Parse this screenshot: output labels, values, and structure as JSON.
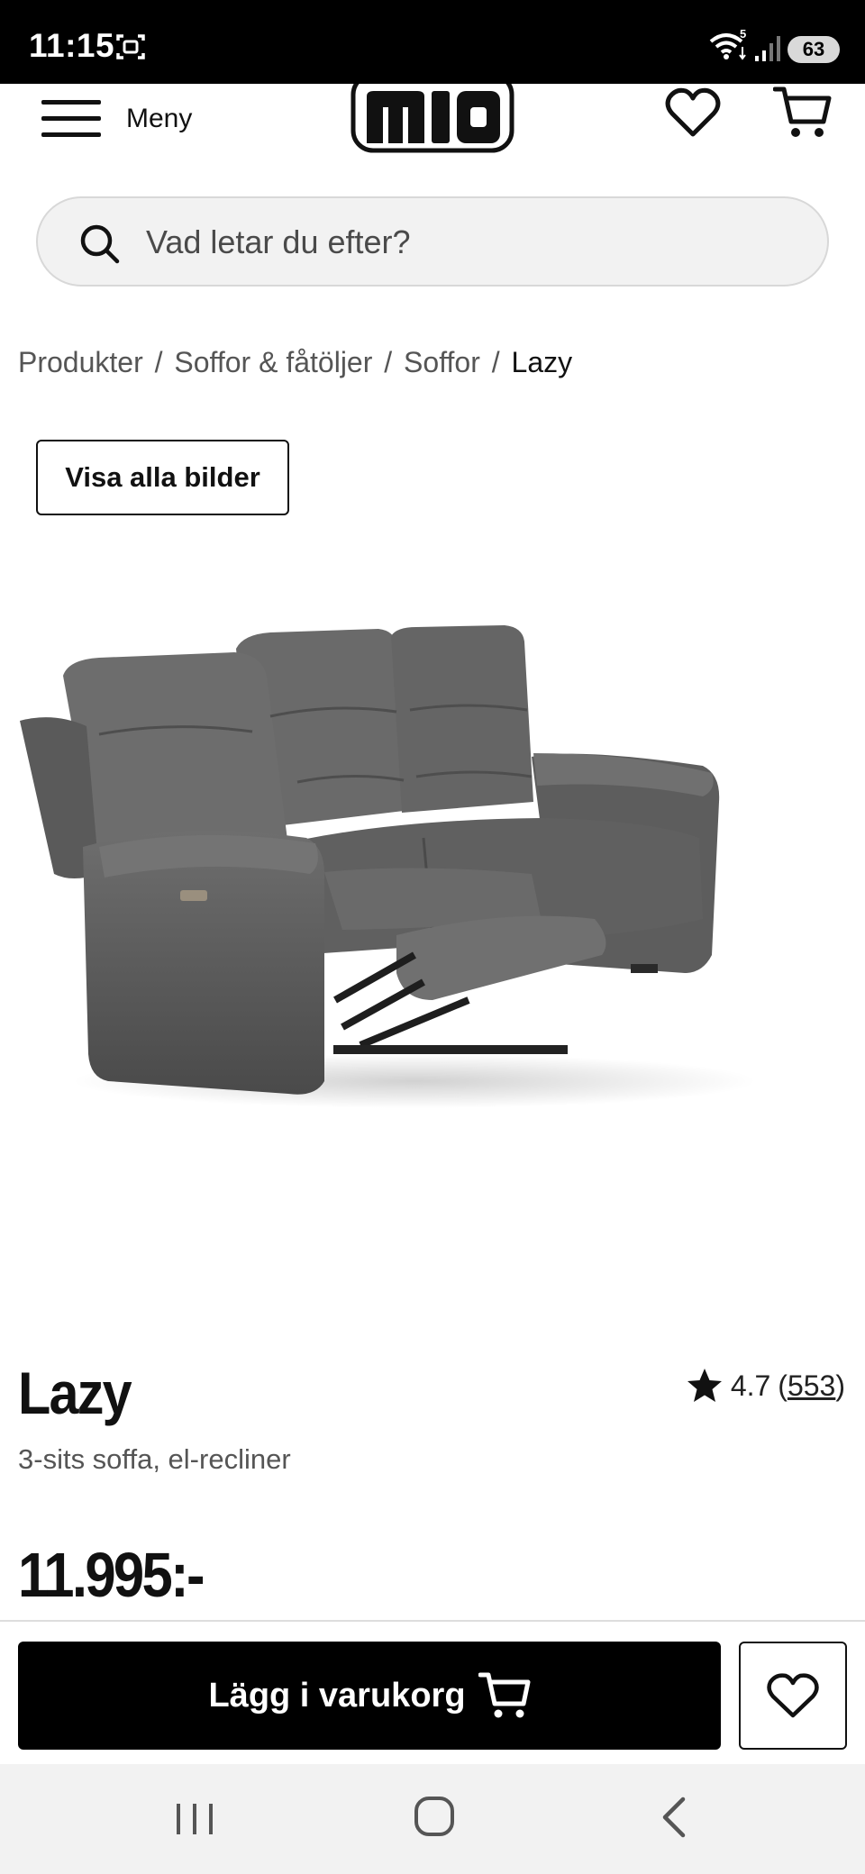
{
  "status_bar": {
    "time": "11:15",
    "battery": "63",
    "icons": [
      "screenshot-icon",
      "wifi-icon",
      "signal-icon",
      "battery-icon"
    ]
  },
  "header": {
    "menu_label": "Meny",
    "logo_text": "mio",
    "icons": [
      "hamburger-menu-icon",
      "heart-icon",
      "cart-icon"
    ]
  },
  "search": {
    "placeholder": "Vad letar du efter?",
    "value": ""
  },
  "breadcrumb": {
    "items": [
      "Produkter",
      "Soffor & fåtöljer",
      "Soffor"
    ],
    "current": "Lazy",
    "separator": "/"
  },
  "gallery": {
    "show_all_label": "Visa alla bilder"
  },
  "product": {
    "name": "Lazy",
    "subtitle": "3-sits soffa, el-recliner",
    "rating": "4.7",
    "review_count": "553",
    "price": "11.995:-"
  },
  "actions": {
    "add_to_cart_label": "Lägg i varukorg"
  },
  "colors": {
    "primary": "#000000",
    "search_bg": "#f2f2f2",
    "sofa": "#5a5a5a"
  }
}
